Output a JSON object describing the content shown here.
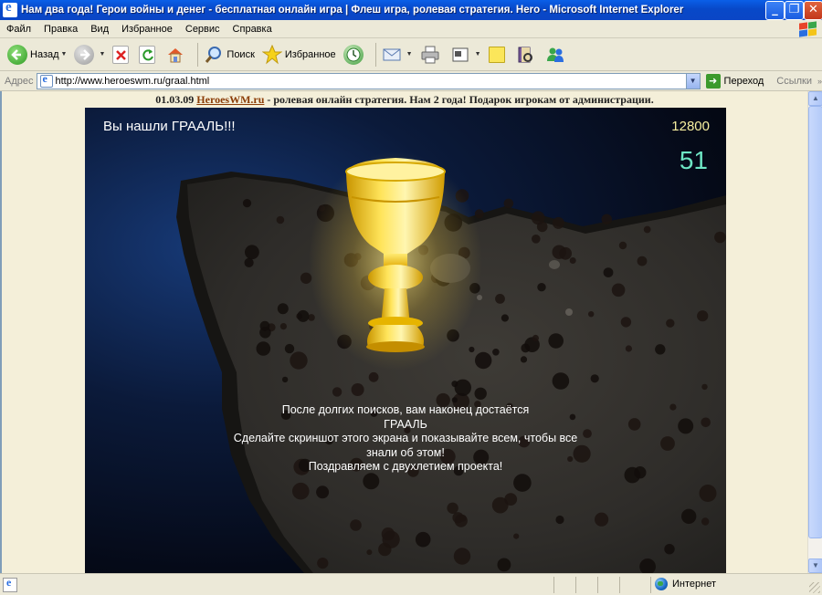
{
  "window": {
    "title": "Нам два года! Герои войны и денег - бесплатная онлайн игра | Флеш игра, ролевая стратегия. Hero - Microsoft Internet Explorer",
    "min_symbol": "_",
    "max_symbol": "❐",
    "close_symbol": "✕"
  },
  "menu": [
    "Файл",
    "Правка",
    "Вид",
    "Избранное",
    "Сервис",
    "Справка"
  ],
  "toolbar": {
    "back_label": "Назад",
    "search_label": "Поиск",
    "favorites_label": "Избранное"
  },
  "address": {
    "label": "Адрес",
    "url": "http://www.heroeswm.ru/graal.html",
    "go_label": "Переход",
    "links_label": "Ссылки"
  },
  "banner": {
    "date": "01.03.09",
    "site": "HeroesWM.ru",
    "text": " - ролевая онлайн стратегия. Нам 2 года! Подарок игрокам от администрации."
  },
  "game": {
    "found_title": "Вы нашли ГРААЛЬ!!!",
    "score": "12800",
    "timer": "51",
    "message": [
      "После долгих поисков, вам наконец достаётся",
      "ГРААЛЬ",
      "Сделайте скриншот этого экрана и показывайте всем, чтобы все",
      "знали об этом!",
      "Поздравляем с двухлетием проекта!"
    ]
  },
  "status": {
    "zone_label": "Интернет"
  },
  "colors": {
    "titlebar": "#0a5fe8",
    "chrome": "#ece9d8",
    "grail_gold": "#f5c400",
    "timer": "#6ee6c4",
    "score": "#f7efa0"
  }
}
